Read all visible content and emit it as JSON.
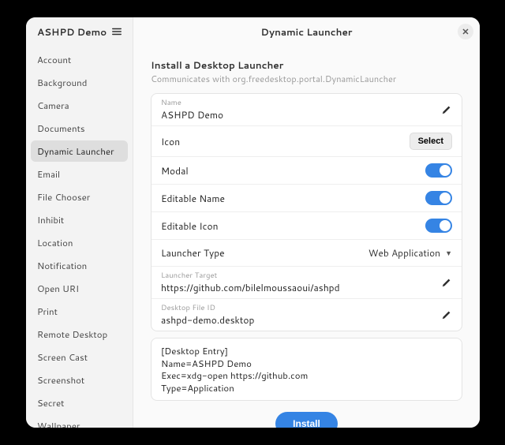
{
  "app_title": "ASHPD Demo",
  "header_title": "Dynamic Launcher",
  "sidebar": {
    "items": [
      {
        "label": "Account",
        "selected": false
      },
      {
        "label": "Background",
        "selected": false
      },
      {
        "label": "Camera",
        "selected": false
      },
      {
        "label": "Documents",
        "selected": false
      },
      {
        "label": "Dynamic Launcher",
        "selected": true
      },
      {
        "label": "Email",
        "selected": false
      },
      {
        "label": "File Chooser",
        "selected": false
      },
      {
        "label": "Inhibit",
        "selected": false
      },
      {
        "label": "Location",
        "selected": false
      },
      {
        "label": "Notification",
        "selected": false
      },
      {
        "label": "Open URI",
        "selected": false
      },
      {
        "label": "Print",
        "selected": false
      },
      {
        "label": "Remote Desktop",
        "selected": false
      },
      {
        "label": "Screen Cast",
        "selected": false
      },
      {
        "label": "Screenshot",
        "selected": false
      },
      {
        "label": "Secret",
        "selected": false
      },
      {
        "label": "Wallpaper",
        "selected": false
      }
    ]
  },
  "section": {
    "title": "Install a Desktop Launcher",
    "subtitle": "Communicates with org.freedesktop.portal.DynamicLauncher"
  },
  "form": {
    "name_label": "Name",
    "name_value": "ASHPD Demo",
    "icon_label": "Icon",
    "icon_select": "Select",
    "modal_label": "Modal",
    "editable_name_label": "Editable Name",
    "editable_icon_label": "Editable Icon",
    "launcher_type_label": "Launcher Type",
    "launcher_type_value": "Web Application",
    "launcher_target_label": "Launcher Target",
    "launcher_target_value": "https://github.com/bilelmoussaoui/ashpd",
    "desktop_file_id_label": "Desktop File ID",
    "desktop_file_id_value": "ashpd-demo.desktop",
    "entry_text": "[Desktop Entry]\nName=ASHPD Demo\nExec=xdg-open https://github.com\nType=Application",
    "install_label": "Install"
  },
  "toggles": {
    "modal": true,
    "editable_name": true,
    "editable_icon": true
  },
  "colors": {
    "accent": "#3584e4"
  }
}
